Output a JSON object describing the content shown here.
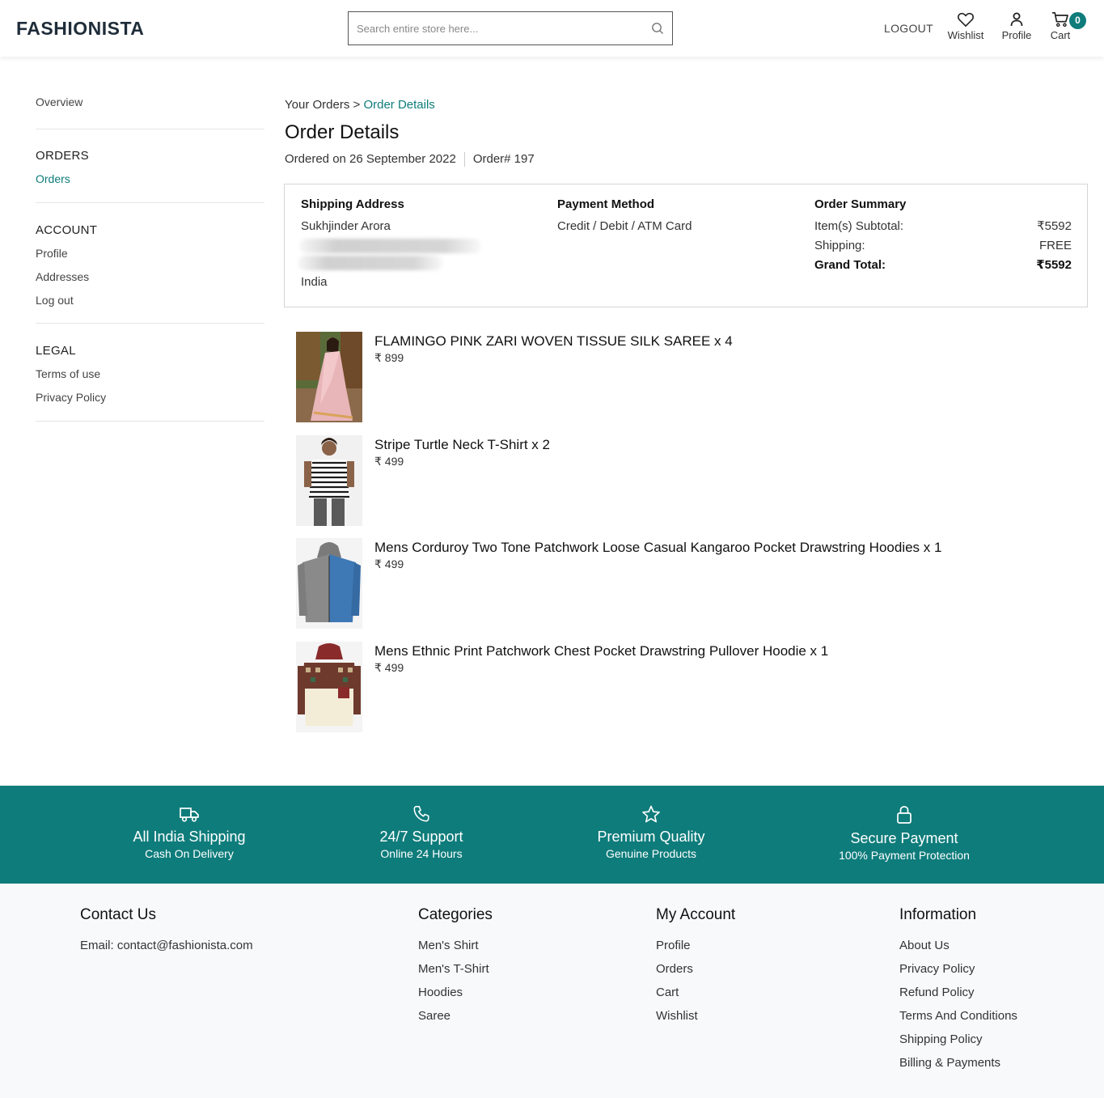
{
  "header": {
    "logo": "FASHIONISTA",
    "search_placeholder": "Search entire store here...",
    "logout": "LOGOUT",
    "wishlist": "Wishlist",
    "profile": "Profile",
    "cart": "Cart",
    "cart_count": "0"
  },
  "sidebar": {
    "overview": "Overview",
    "orders_heading": "ORDERS",
    "orders": "Orders",
    "account_heading": "ACCOUNT",
    "profile": "Profile",
    "addresses": "Addresses",
    "logout": "Log out",
    "legal_heading": "LEGAL",
    "terms": "Terms of use",
    "privacy": "Privacy Policy"
  },
  "breadcrumb": {
    "parent": "Your Orders",
    "separator": ">",
    "current": "Order Details"
  },
  "page_title": "Order Details",
  "order_meta": {
    "ordered_on": "Ordered on 26 September 2022",
    "order_number": "Order# 197"
  },
  "shipping": {
    "title": "Shipping Address",
    "name": "Sukhjinder Arora",
    "country": "India"
  },
  "payment": {
    "title": "Payment Method",
    "method": "Credit / Debit / ATM Card"
  },
  "summary": {
    "title": "Order Summary",
    "subtotal_label": "Item(s) Subtotal:",
    "subtotal_value": "₹5592",
    "shipping_label": "Shipping:",
    "shipping_value": "FREE",
    "total_label": "Grand Total:",
    "total_value": "₹5592"
  },
  "items": [
    {
      "name": "FLAMINGO PINK ZARI WOVEN TISSUE SILK SAREE x 4",
      "price": "₹ 899"
    },
    {
      "name": "Stripe Turtle Neck T-Shirt x 2",
      "price": "₹ 499"
    },
    {
      "name": "Mens Corduroy Two Tone Patchwork Loose Casual Kangaroo Pocket Drawstring Hoodies x 1",
      "price": "₹ 499"
    },
    {
      "name": "Mens Ethnic Print Patchwork Chest Pocket Drawstring Pullover Hoodie x 1",
      "price": "₹ 499"
    }
  ],
  "features": [
    {
      "title": "All India Shipping",
      "subtitle": "Cash On Delivery",
      "icon": "truck-icon"
    },
    {
      "title": "24/7 Support",
      "subtitle": "Online 24 Hours",
      "icon": "phone-icon"
    },
    {
      "title": "Premium Quality",
      "subtitle": "Genuine Products",
      "icon": "star-icon"
    },
    {
      "title": "Secure Payment",
      "subtitle": "100% Payment Protection",
      "icon": "lock-icon"
    }
  ],
  "footer": {
    "contact": {
      "title": "Contact Us",
      "email": "Email: contact@fashionista.com"
    },
    "categories": {
      "title": "Categories",
      "links": [
        "Men's Shirt",
        "Men's T-Shirt",
        "Hoodies",
        "Saree"
      ]
    },
    "account": {
      "title": "My Account",
      "links": [
        "Profile",
        "Orders",
        "Cart",
        "Wishlist"
      ]
    },
    "information": {
      "title": "Information",
      "links": [
        "About Us",
        "Privacy Policy",
        "Refund Policy",
        "Terms And Conditions",
        "Shipping Policy",
        "Billing & Payments"
      ]
    }
  },
  "colors": {
    "accent": "#0e7c7b"
  }
}
